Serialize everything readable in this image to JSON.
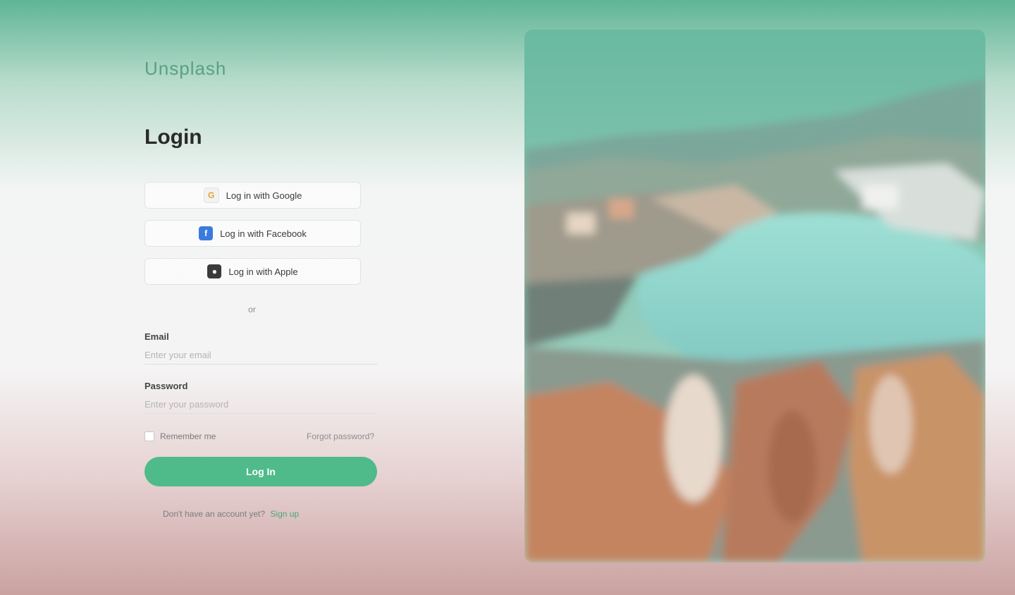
{
  "brand": {
    "logo_text": "Unsplash"
  },
  "login": {
    "title": "Login",
    "social": {
      "google_label": "Log in with Google",
      "facebook_label": "Log in with Facebook",
      "apple_label": "Log in with Apple",
      "google_icon": "google-icon",
      "facebook_icon": "facebook-icon",
      "apple_icon": "apple-icon"
    },
    "divider": "or",
    "email": {
      "label": "Email",
      "placeholder": "Enter your email"
    },
    "password": {
      "label": "Password",
      "placeholder": "Enter your password"
    },
    "remember_label": "Remember me",
    "forgot_label": "Forgot password?",
    "submit_label": "Log In",
    "signup_prompt": "Don't have an account yet?",
    "signup_link": "Sign up"
  },
  "colors": {
    "accent": "#4fba8a",
    "background_top": "#5fb596",
    "background_bottom": "#c9a2a0"
  }
}
